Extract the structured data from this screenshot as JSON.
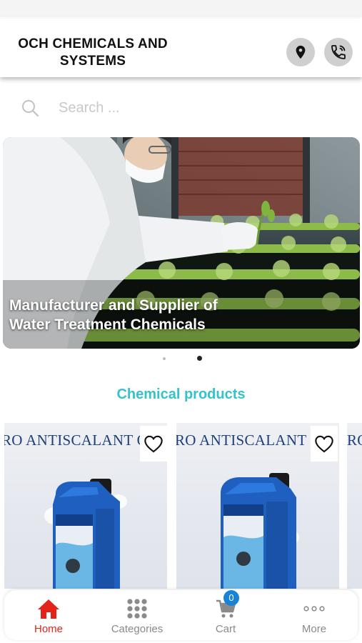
{
  "header": {
    "brand": "OCH CHEMICALS AND SYSTEMS",
    "location_icon": "map-pin-icon",
    "phone_icon": "phone-call-icon"
  },
  "search": {
    "placeholder": "Search ...",
    "icon": "search-icon"
  },
  "banner": {
    "caption_line1": "Manufacturer and Supplier of",
    "caption_line2": "Water Treatment Chemicals",
    "active_slide": 2,
    "slide_count": 2
  },
  "section": {
    "title": "Chemical products"
  },
  "products": [
    {
      "label": "RO ANTISCALANT   OC",
      "favorite_icon": "heart-outline-icon"
    },
    {
      "label": "RO ANTISCALANT   OC",
      "favorite_icon": "heart-outline-icon"
    },
    {
      "label": "RO",
      "favorite_icon": "heart-outline-icon"
    }
  ],
  "tabbar": {
    "tabs": [
      {
        "label": "Home",
        "icon": "home-icon",
        "active": true
      },
      {
        "label": "Categories",
        "icon": "grid-icon",
        "active": false
      },
      {
        "label": "Cart",
        "icon": "cart-icon",
        "active": false,
        "badge": "0"
      },
      {
        "label": "More",
        "icon": "more-dots-icon",
        "active": false
      }
    ]
  },
  "colors": {
    "accent_teal": "#33c3c9",
    "active_red": "#e3241b",
    "badge_blue": "#1783d6"
  }
}
